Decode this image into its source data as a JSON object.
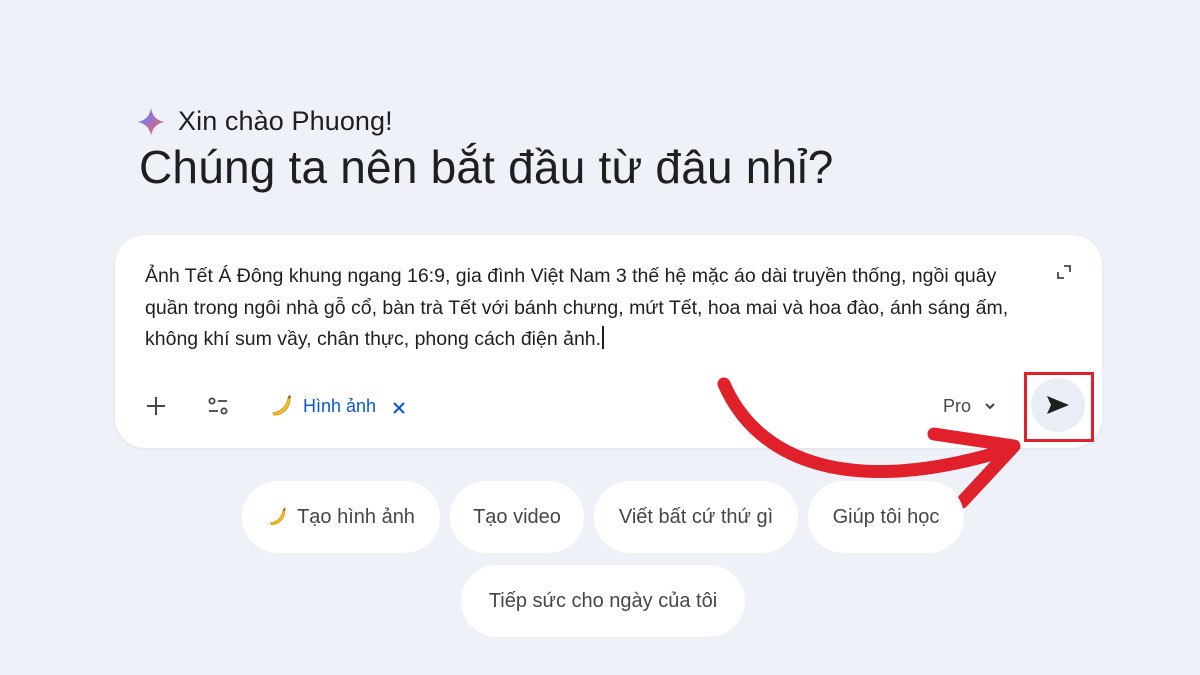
{
  "greeting": {
    "text": "Xin chào Phuong!",
    "icon": "gemini-spark-icon"
  },
  "headline": "Chúng ta nên bắt đầu từ đâu nhỉ?",
  "composer": {
    "prompt_text": "Ảnh Tết Á Đông khung ngang 16:9, gia đình Việt Nam 3 thế hệ mặc áo dài truyền thống, ngồi quây quần trong ngôi nhà gỗ cổ, bàn trà Tết với bánh chưng, mứt Tết, hoa mai và hoa đào, ánh sáng ấm, không khí sum vầy, chân thực, phong cách điện ảnh.",
    "tool_chip": {
      "label": "Hình ảnh",
      "icon": "banana-icon",
      "close_glyph": "✕"
    },
    "model_selector": {
      "label": "Pro",
      "icon": "chevron-down-icon"
    },
    "send_icon": "send-icon",
    "accent_color": "#0b57d0"
  },
  "annotation": {
    "highlight_color": "#e0202a"
  },
  "suggestions": [
    {
      "label": "Tạo hình ảnh",
      "icon": "banana-icon"
    },
    {
      "label": "Tạo video"
    },
    {
      "label": "Viết bất cứ thứ gì"
    },
    {
      "label": "Giúp tôi học"
    },
    {
      "label": "Tiếp sức cho ngày của tôi"
    }
  ]
}
